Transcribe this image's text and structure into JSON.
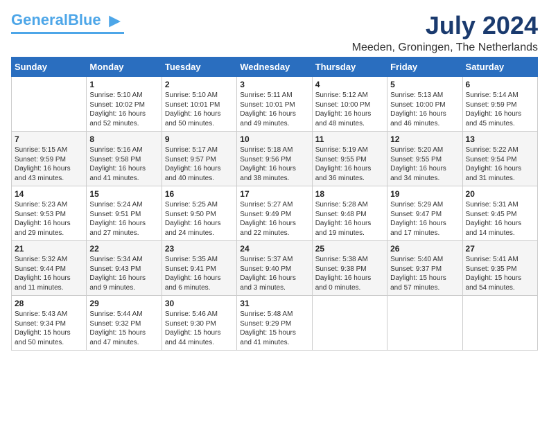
{
  "header": {
    "logo_general": "General",
    "logo_blue": "Blue",
    "month_year": "July 2024",
    "location": "Meeden, Groningen, The Netherlands"
  },
  "days_of_week": [
    "Sunday",
    "Monday",
    "Tuesday",
    "Wednesday",
    "Thursday",
    "Friday",
    "Saturday"
  ],
  "weeks": [
    [
      {
        "day": "",
        "content": ""
      },
      {
        "day": "1",
        "content": "Sunrise: 5:10 AM\nSunset: 10:02 PM\nDaylight: 16 hours\nand 52 minutes."
      },
      {
        "day": "2",
        "content": "Sunrise: 5:10 AM\nSunset: 10:01 PM\nDaylight: 16 hours\nand 50 minutes."
      },
      {
        "day": "3",
        "content": "Sunrise: 5:11 AM\nSunset: 10:01 PM\nDaylight: 16 hours\nand 49 minutes."
      },
      {
        "day": "4",
        "content": "Sunrise: 5:12 AM\nSunset: 10:00 PM\nDaylight: 16 hours\nand 48 minutes."
      },
      {
        "day": "5",
        "content": "Sunrise: 5:13 AM\nSunset: 10:00 PM\nDaylight: 16 hours\nand 46 minutes."
      },
      {
        "day": "6",
        "content": "Sunrise: 5:14 AM\nSunset: 9:59 PM\nDaylight: 16 hours\nand 45 minutes."
      }
    ],
    [
      {
        "day": "7",
        "content": "Sunrise: 5:15 AM\nSunset: 9:59 PM\nDaylight: 16 hours\nand 43 minutes."
      },
      {
        "day": "8",
        "content": "Sunrise: 5:16 AM\nSunset: 9:58 PM\nDaylight: 16 hours\nand 41 minutes."
      },
      {
        "day": "9",
        "content": "Sunrise: 5:17 AM\nSunset: 9:57 PM\nDaylight: 16 hours\nand 40 minutes."
      },
      {
        "day": "10",
        "content": "Sunrise: 5:18 AM\nSunset: 9:56 PM\nDaylight: 16 hours\nand 38 minutes."
      },
      {
        "day": "11",
        "content": "Sunrise: 5:19 AM\nSunset: 9:55 PM\nDaylight: 16 hours\nand 36 minutes."
      },
      {
        "day": "12",
        "content": "Sunrise: 5:20 AM\nSunset: 9:55 PM\nDaylight: 16 hours\nand 34 minutes."
      },
      {
        "day": "13",
        "content": "Sunrise: 5:22 AM\nSunset: 9:54 PM\nDaylight: 16 hours\nand 31 minutes."
      }
    ],
    [
      {
        "day": "14",
        "content": "Sunrise: 5:23 AM\nSunset: 9:53 PM\nDaylight: 16 hours\nand 29 minutes."
      },
      {
        "day": "15",
        "content": "Sunrise: 5:24 AM\nSunset: 9:51 PM\nDaylight: 16 hours\nand 27 minutes."
      },
      {
        "day": "16",
        "content": "Sunrise: 5:25 AM\nSunset: 9:50 PM\nDaylight: 16 hours\nand 24 minutes."
      },
      {
        "day": "17",
        "content": "Sunrise: 5:27 AM\nSunset: 9:49 PM\nDaylight: 16 hours\nand 22 minutes."
      },
      {
        "day": "18",
        "content": "Sunrise: 5:28 AM\nSunset: 9:48 PM\nDaylight: 16 hours\nand 19 minutes."
      },
      {
        "day": "19",
        "content": "Sunrise: 5:29 AM\nSunset: 9:47 PM\nDaylight: 16 hours\nand 17 minutes."
      },
      {
        "day": "20",
        "content": "Sunrise: 5:31 AM\nSunset: 9:45 PM\nDaylight: 16 hours\nand 14 minutes."
      }
    ],
    [
      {
        "day": "21",
        "content": "Sunrise: 5:32 AM\nSunset: 9:44 PM\nDaylight: 16 hours\nand 11 minutes."
      },
      {
        "day": "22",
        "content": "Sunrise: 5:34 AM\nSunset: 9:43 PM\nDaylight: 16 hours\nand 9 minutes."
      },
      {
        "day": "23",
        "content": "Sunrise: 5:35 AM\nSunset: 9:41 PM\nDaylight: 16 hours\nand 6 minutes."
      },
      {
        "day": "24",
        "content": "Sunrise: 5:37 AM\nSunset: 9:40 PM\nDaylight: 16 hours\nand 3 minutes."
      },
      {
        "day": "25",
        "content": "Sunrise: 5:38 AM\nSunset: 9:38 PM\nDaylight: 16 hours\nand 0 minutes."
      },
      {
        "day": "26",
        "content": "Sunrise: 5:40 AM\nSunset: 9:37 PM\nDaylight: 15 hours\nand 57 minutes."
      },
      {
        "day": "27",
        "content": "Sunrise: 5:41 AM\nSunset: 9:35 PM\nDaylight: 15 hours\nand 54 minutes."
      }
    ],
    [
      {
        "day": "28",
        "content": "Sunrise: 5:43 AM\nSunset: 9:34 PM\nDaylight: 15 hours\nand 50 minutes."
      },
      {
        "day": "29",
        "content": "Sunrise: 5:44 AM\nSunset: 9:32 PM\nDaylight: 15 hours\nand 47 minutes."
      },
      {
        "day": "30",
        "content": "Sunrise: 5:46 AM\nSunset: 9:30 PM\nDaylight: 15 hours\nand 44 minutes."
      },
      {
        "day": "31",
        "content": "Sunrise: 5:48 AM\nSunset: 9:29 PM\nDaylight: 15 hours\nand 41 minutes."
      },
      {
        "day": "",
        "content": ""
      },
      {
        "day": "",
        "content": ""
      },
      {
        "day": "",
        "content": ""
      }
    ]
  ]
}
